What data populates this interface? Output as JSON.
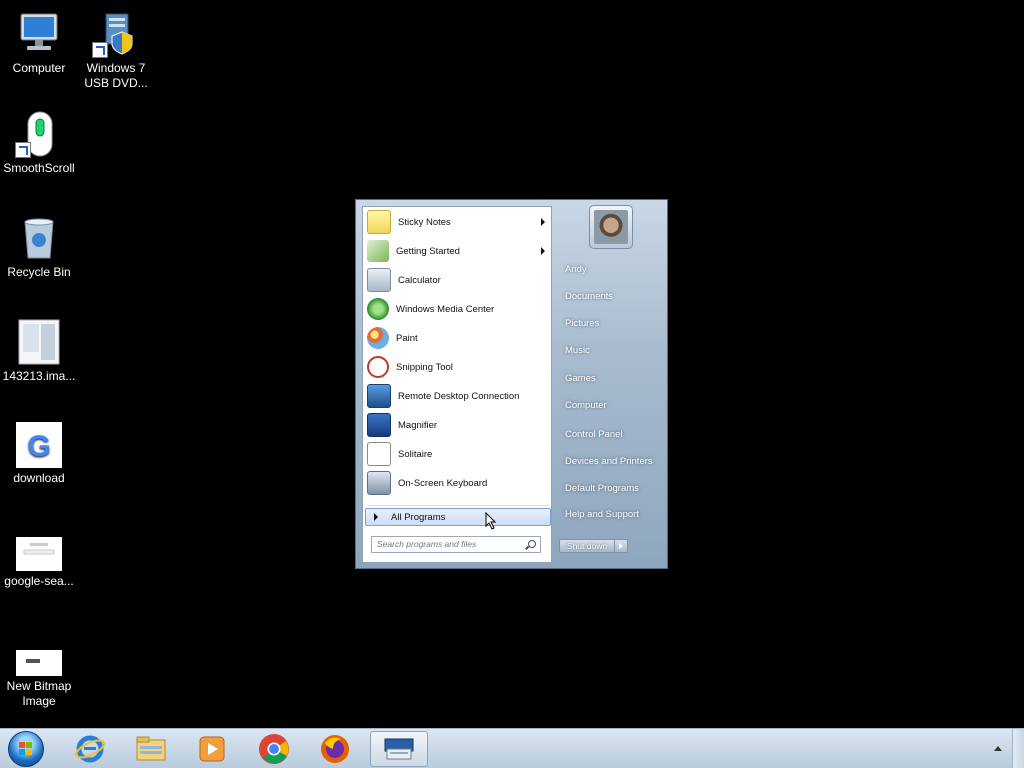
{
  "desktop": {
    "icons": [
      {
        "label": "Computer",
        "icon": "computer-icon"
      },
      {
        "label": "Windows 7 USB DVD...",
        "icon": "usb-dvd-tool-icon"
      },
      {
        "label": "SmoothScroll",
        "icon": "mouse-icon"
      },
      {
        "label": "Recycle Bin",
        "icon": "recycle-bin-icon"
      },
      {
        "label": "143213.ima...",
        "icon": "image-file-icon"
      },
      {
        "label": "download",
        "icon": "google-logo-icon"
      },
      {
        "label": "google-sea...",
        "icon": "image-file-icon"
      },
      {
        "label": "New Bitmap Image",
        "icon": "bitmap-file-icon"
      }
    ]
  },
  "start_menu": {
    "programs": [
      {
        "label": "Sticky Notes",
        "has_submenu": true,
        "icon": "sticky-notes-icon"
      },
      {
        "label": "Getting Started",
        "has_submenu": true,
        "icon": "getting-started-icon"
      },
      {
        "label": "Calculator",
        "has_submenu": false,
        "icon": "calculator-icon"
      },
      {
        "label": "Windows Media Center",
        "has_submenu": false,
        "icon": "media-center-icon"
      },
      {
        "label": "Paint",
        "has_submenu": false,
        "icon": "paint-icon"
      },
      {
        "label": "Snipping Tool",
        "has_submenu": false,
        "icon": "scissors-icon"
      },
      {
        "label": "Remote Desktop Connection",
        "has_submenu": false,
        "icon": "remote-desktop-icon"
      },
      {
        "label": "Magnifier",
        "has_submenu": false,
        "icon": "magnifier-icon"
      },
      {
        "label": "Solitaire",
        "has_submenu": false,
        "icon": "solitaire-icon"
      },
      {
        "label": "On-Screen Keyboard",
        "has_submenu": false,
        "icon": "keyboard-icon"
      }
    ],
    "all_programs": "All Programs",
    "search_placeholder": "Search programs and files",
    "right_links": [
      "Andy",
      "Documents",
      "Pictures",
      "Music",
      "Games",
      "Computer",
      "Control Panel",
      "Devices and Printers",
      "Default Programs",
      "Help and Support"
    ],
    "shutdown_label": "Shut down"
  },
  "taskbar": {
    "pinned": [
      {
        "name": "internet-explorer",
        "icon": "internet-explorer-icon"
      },
      {
        "name": "windows-explorer",
        "icon": "folder-icon"
      },
      {
        "name": "windows-media-player",
        "icon": "media-player-icon"
      },
      {
        "name": "google-chrome",
        "icon": "chrome-icon"
      },
      {
        "name": "firefox",
        "icon": "firefox-icon"
      },
      {
        "name": "on-screen-keyboard",
        "icon": "keyboard-icon",
        "active": true
      }
    ]
  },
  "colors": {
    "desktop_bg": "#000000",
    "taskbar": "#c9d8e8",
    "selection": "#c9ddf5"
  }
}
